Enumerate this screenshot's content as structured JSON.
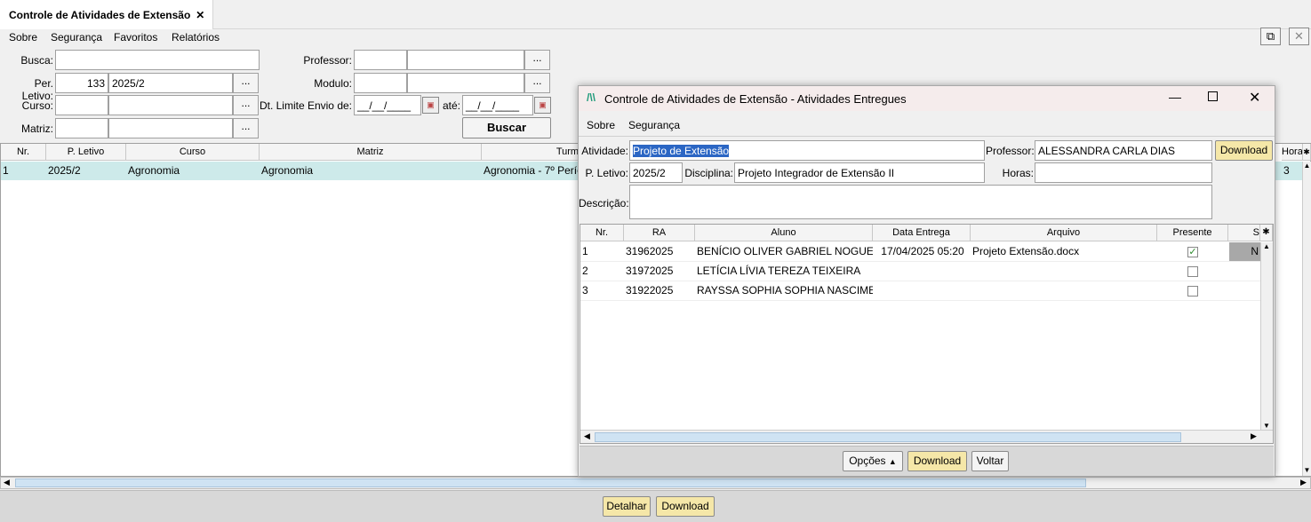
{
  "tab": {
    "title": "Controle de Atividades de Extensão",
    "close": "✕"
  },
  "menu": {
    "sobre": "Sobre",
    "seguranca": "Segurança",
    "favoritos": "Favoritos",
    "relatorios": "Relatórios"
  },
  "filters": {
    "busca_label": "Busca:",
    "busca_value": "",
    "per_letivo_label": "Per. Letivo:",
    "per_letivo_code": "133",
    "per_letivo_value": "2025/2",
    "curso_label": "Curso:",
    "matriz_label": "Matriz:",
    "professor_label": "Professor:",
    "modulo_label": "Modulo:",
    "dt_limite_label": "Dt. Limite Envio de:",
    "date_from": "__/__/____",
    "ate_label": "até:",
    "date_to": "__/__/____",
    "ellipsis": "...",
    "buscar": "Buscar"
  },
  "main_grid": {
    "headers": [
      "Nr.",
      "P. Letivo",
      "Curso",
      "Matriz",
      "Turma",
      "Hora"
    ],
    "row": {
      "nr": "1",
      "letivo": "2025/2",
      "curso": "Agronomia",
      "matriz": "Agronomia",
      "turma": "Agronomia - 7º Perío",
      "hora": "3"
    }
  },
  "bottom": {
    "detalhar": "Detalhar",
    "download": "Download"
  },
  "dialog": {
    "title": "Controle de Atividades de Extensão - Atividades Entregues",
    "menu_sobre": "Sobre",
    "menu_seguranca": "Segurança",
    "atividade_label": "Atividade:",
    "atividade_value": "Projeto de Extensão",
    "professor_label": "Professor:",
    "professor_value": "ALESSANDRA CARLA DIAS",
    "download": "Download",
    "letivo_label": "P. Letivo:",
    "letivo_value": "2025/2",
    "disciplina_label": "Disciplina:",
    "disciplina_value": "Projeto Integrador de Extensão II",
    "horas_label": "Horas:",
    "horas_value": "",
    "descricao_label": "Descrição:",
    "descricao_value": "",
    "headers": [
      "Nr.",
      "RA",
      "Aluno",
      "Data Entrega",
      "Arquivo",
      "Presente",
      "S"
    ],
    "rows": [
      {
        "nr": "1",
        "ra": "31962025",
        "aluno": "BENÍCIO OLIVER GABRIEL NOGUEIRA",
        "data": "17/04/2025 05:20",
        "arquivo": "Projeto Extensão.docx",
        "presente": true,
        "s": "N"
      },
      {
        "nr": "2",
        "ra": "31972025",
        "aluno": "LETÍCIA LÍVIA TEREZA TEIXEIRA",
        "data": "",
        "arquivo": "",
        "presente": false,
        "s": ""
      },
      {
        "nr": "3",
        "ra": "31922025",
        "aluno": "RAYSSA SOPHIA SOPHIA NASCIME...",
        "data": "",
        "arquivo": "",
        "presente": false,
        "s": ""
      }
    ],
    "opcoes": "Opções",
    "voltar": "Voltar"
  }
}
